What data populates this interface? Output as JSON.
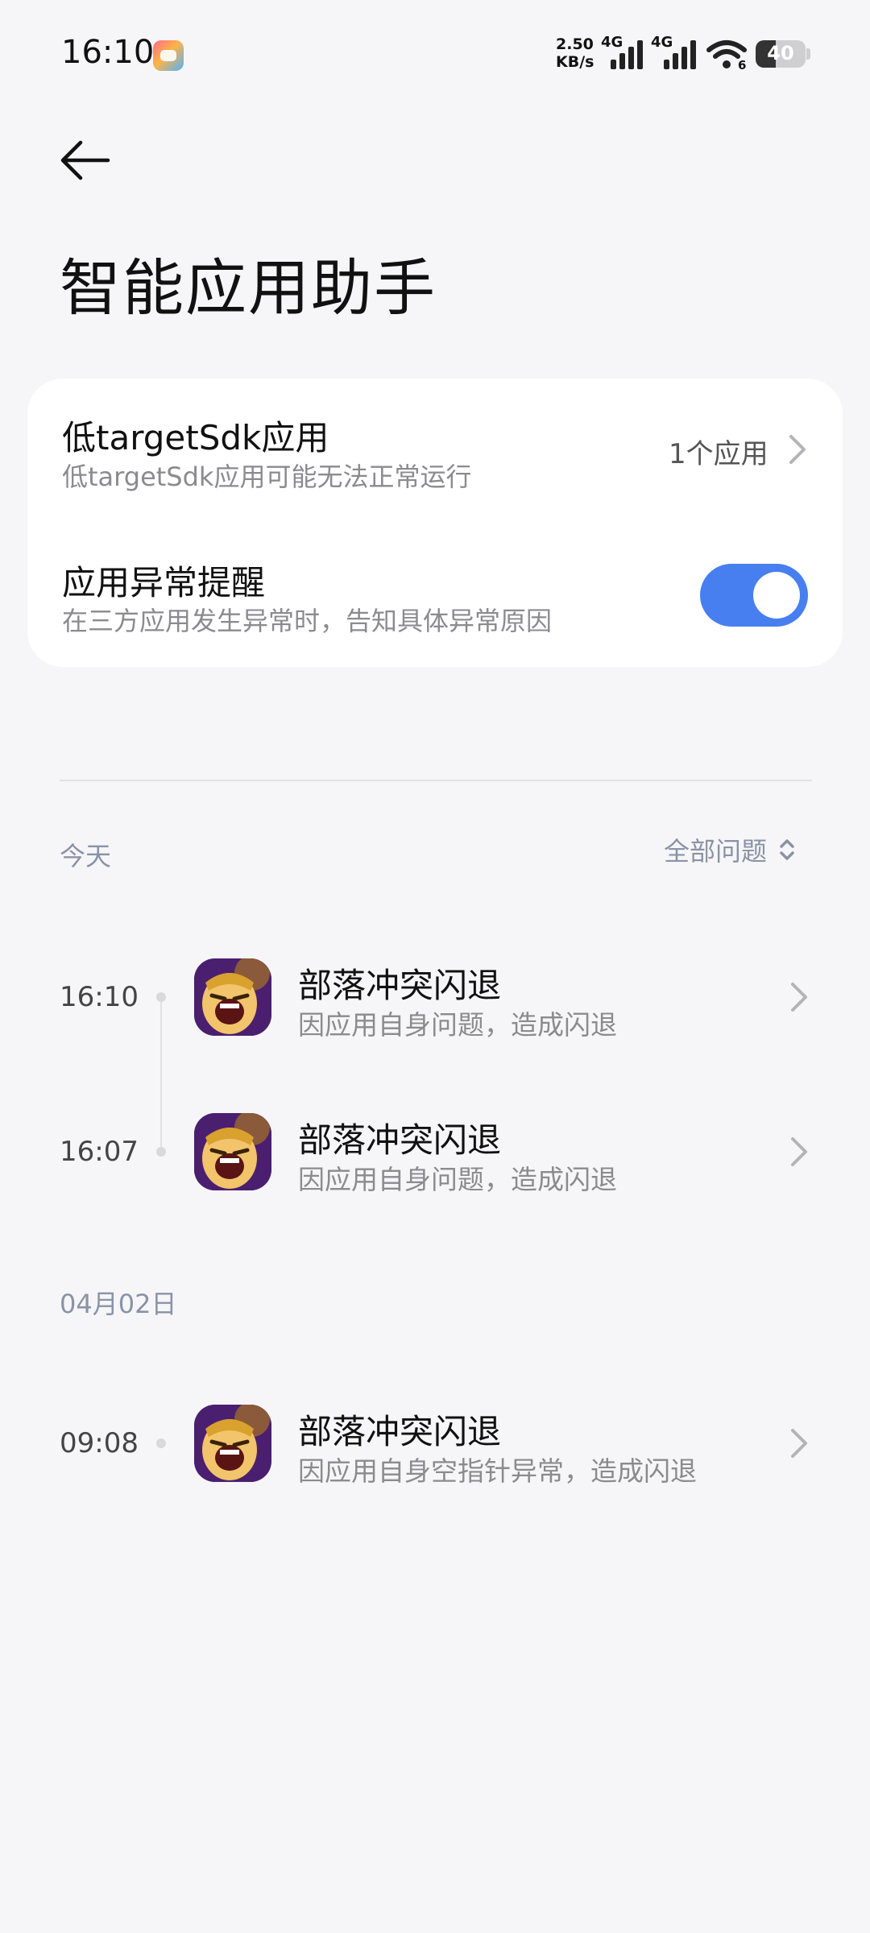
{
  "status_bar": {
    "time": "16:10",
    "net_speed_value": "2.50",
    "net_speed_unit": "KB/s",
    "signal1_label": "4G",
    "signal2_label": "4G",
    "wifi_label": "6",
    "battery": "40",
    "battery_level": 0.4,
    "icons": [
      "gamepad-app-icon",
      "signal-icon",
      "signal-icon",
      "wifi-icon",
      "battery-icon"
    ]
  },
  "header": {
    "back_icon": "arrow-left-icon",
    "title": "智能应用助手"
  },
  "settings": {
    "low_sdk": {
      "title": "低targetSdk应用",
      "subtitle": "低targetSdk应用可能无法正常运行",
      "value": "1个应用"
    },
    "anomaly_alert": {
      "title": "应用异常提醒",
      "subtitle": "在三方应用发生异常时，告知具体异常原因",
      "enabled": true,
      "accent": "#477ff0"
    }
  },
  "records": {
    "filter_label": "全部问题",
    "groups": [
      {
        "date": "今天",
        "items": [
          {
            "time": "16:10",
            "title": "部落冲突闪退",
            "subtitle": "因应用自身问题，造成闪退"
          },
          {
            "time": "16:07",
            "title": "部落冲突闪退",
            "subtitle": "因应用自身问题，造成闪退"
          }
        ]
      },
      {
        "date": "04月02日",
        "items": [
          {
            "time": "09:08",
            "title": "部落冲突闪退",
            "subtitle": "因应用自身空指针异常，造成闪退"
          }
        ]
      }
    ]
  }
}
